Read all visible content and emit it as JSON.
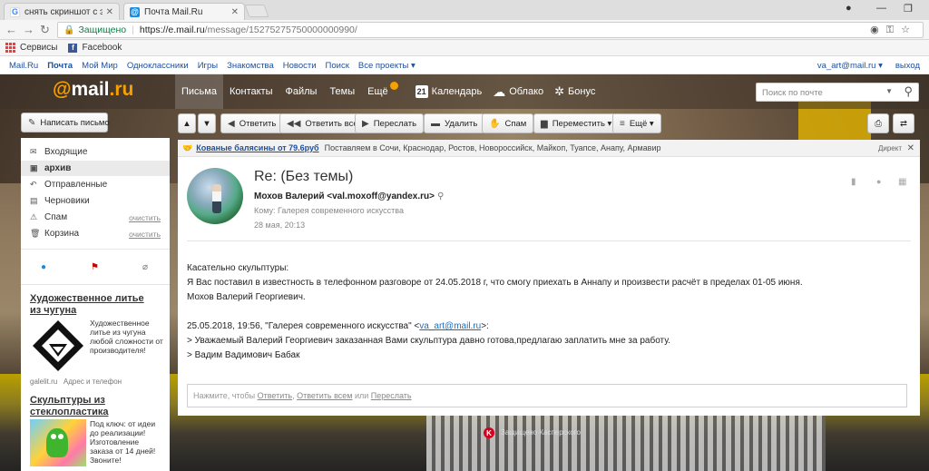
{
  "browser": {
    "tabs": [
      {
        "title": "снять скриншот с экрана",
        "favicon": "G"
      },
      {
        "title": "Почта Mail.Ru",
        "favicon": "@"
      }
    ],
    "secure_label": "Защищено",
    "url_host": "https://e.mail.ru",
    "url_path": "/message/15275275750000000990/",
    "bookmarks": [
      {
        "label": "Сервисы"
      },
      {
        "label": "Facebook",
        "icon": "f"
      }
    ]
  },
  "portal": {
    "links": [
      "Mail.Ru",
      "Почта",
      "Мой Мир",
      "Одноклассники",
      "Игры",
      "Знакомства",
      "Новости",
      "Поиск",
      "Все проекты ▾"
    ],
    "user": "va_art@mail.ru ▾",
    "logout": "выход"
  },
  "header": {
    "logo_at": "@",
    "logo_mail": "mail",
    "logo_ru": ".ru",
    "nav": [
      "Письма",
      "Контакты",
      "Файлы",
      "Темы",
      "Ещё"
    ],
    "apps": [
      {
        "label": "Календарь",
        "icon": "21"
      },
      {
        "label": "Облако",
        "icon": "☁"
      },
      {
        "label": "Бонус",
        "icon": "✲"
      }
    ],
    "search_placeholder": "Поиск по почте"
  },
  "actions": {
    "compose": "Написать письмо",
    "reply": "Ответить",
    "reply_all": "Ответить всем",
    "forward": "Переслать",
    "delete": "Удалить",
    "spam": "Спам",
    "move": "Переместить ▾",
    "more": "Ещё ▾"
  },
  "folders": [
    {
      "label": "Входящие",
      "icon": "✉"
    },
    {
      "label": "архив",
      "icon": "▣"
    },
    {
      "label": "Отправленные",
      "icon": "↶"
    },
    {
      "label": "Черновики",
      "icon": "▤"
    },
    {
      "label": "Спам",
      "icon": "⚠",
      "clear": "очистить"
    },
    {
      "label": "Корзина",
      "icon": "🗑",
      "clear": "очистить"
    }
  ],
  "ads": {
    "ad1_title": "Художественное литье из чугуна",
    "ad1_text": "Художественное литье из чугуна любой сложности от производителя!",
    "ad1_domain": "galelit.ru",
    "ad1_contacts": "Адрес и телефон",
    "ad2_title": "Скульптуры из стеклопластика",
    "ad2_text": "Под ключ: от идеи до реализации! Изготовление заказа от 14 дней! Звоните!"
  },
  "adstrip": {
    "link": "Кованые балясины от 79.6руб",
    "desc": "Поставляем в Сочи, Краснодар, Ростов, Новороссийск, Майкоп, Туапсе, Анапу, Армавир",
    "direct": "Директ"
  },
  "message": {
    "subject": "Re: (Без темы)",
    "from": "Мохов Валерий <val.moxoff@yandex.ru>",
    "to": "Кому: Галерея современного искусства",
    "date": "28 мая, 20:13",
    "body": [
      "Касательно скульптуры:",
      "Я Вас поставил в известность в телефонном разговоре от 24.05.2018 г, что смогу приехать в Аннапу и произвести расчёт в пределах 01-05 июня.",
      "Мохов Валерий Георгиевич."
    ],
    "quote_header_pre": "25.05.2018, 19:56, \"Галерея современного искусства\" <",
    "quote_email": "va_art@mail.ru",
    "quote_header_post": ">:",
    "quote_lines": [
      "> Уважаемый Валерий Георгиевич заказанная Вами скульптура давно готова,предлагаю заплатить мне за работу.",
      ">  Вадим Вадимович Бабак"
    ]
  },
  "reply_box": {
    "prefix": "Нажмите, чтобы ",
    "reply": "Ответить",
    "comma": ", ",
    "reply_all": "Ответить всем",
    "or": " или ",
    "forward": "Переслать"
  },
  "kaspersky": "Защищено Касперского",
  "colors": {
    "accent": "#f8a000",
    "link": "#1f4e9a",
    "secure": "#0b8043"
  }
}
